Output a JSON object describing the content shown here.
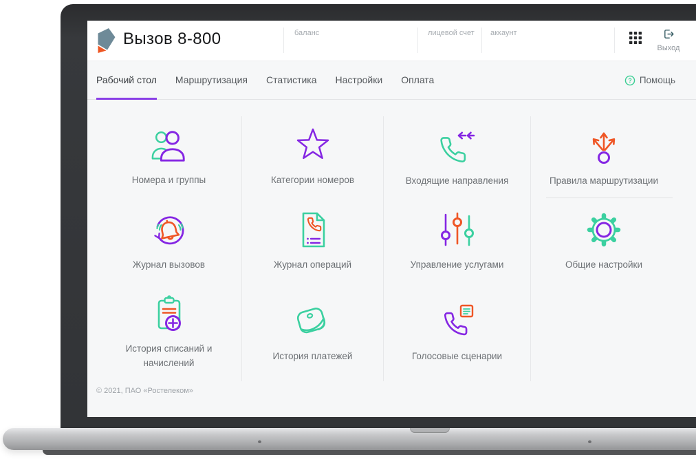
{
  "header": {
    "logo_icon": "rostelecom-logo-icon",
    "title": "Вызов 8-800",
    "balance_label": "баланс",
    "personal_account_label": "лицевой счет",
    "account_label": "аккаунт",
    "apps_icon": "apps-grid-icon",
    "logout": {
      "icon": "logout-icon",
      "label": "Выход"
    }
  },
  "nav": {
    "tabs": [
      {
        "label": "Рабочий стол",
        "active": true
      },
      {
        "label": "Маршрутизация",
        "active": false
      },
      {
        "label": "Статистика",
        "active": false
      },
      {
        "label": "Настройки",
        "active": false
      },
      {
        "label": "Оплата",
        "active": false
      }
    ],
    "help": {
      "icon": "help-question-icon",
      "label": "Помощь"
    }
  },
  "tiles": [
    {
      "label": "Номера и группы",
      "icon": "users-icon"
    },
    {
      "label": "Категории номеров",
      "icon": "star-icon"
    },
    {
      "label": "Входящие направления",
      "icon": "incoming-call-icon"
    },
    {
      "label": "Правила маршрутизации",
      "icon": "routing-arrows-icon"
    },
    {
      "label": "Журнал вызовов",
      "icon": "call-log-bell-icon"
    },
    {
      "label": "Журнал операций",
      "icon": "operations-document-icon"
    },
    {
      "label": "Управление услугами",
      "icon": "sliders-icon"
    },
    {
      "label": "Общие настройки",
      "icon": "gear-icon"
    },
    {
      "label": "История списаний и начислений",
      "icon": "clipboard-plus-icon"
    },
    {
      "label": "История платежей",
      "icon": "wallet-icon"
    },
    {
      "label": "Голосовые сценарии",
      "icon": "voice-script-phone-icon"
    }
  ],
  "footer": {
    "copyright": "© 2021, ПАО «Ростелеком»"
  },
  "colors": {
    "purple": "#8526e3",
    "green": "#3bd0a0",
    "orange": "#ef5626",
    "tab_underline": "#8a3fe6",
    "logo_slate": "#6e8a98",
    "logo_orange": "#ee5724"
  }
}
